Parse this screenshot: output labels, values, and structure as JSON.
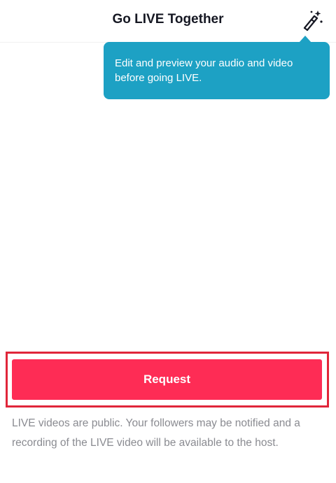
{
  "header": {
    "title": "Go LIVE Together",
    "effects_icon": "magic-wand-icon"
  },
  "tooltip": {
    "text": "Edit and preview your audio and video before going LIVE."
  },
  "request_button": {
    "label": "Request"
  },
  "disclaimer": {
    "text": "LIVE videos are public. Your followers may be notified and a recording of the LIVE video will be available to the host."
  },
  "colors": {
    "accent": "#fe2c55",
    "tooltip": "#1da1c4",
    "highlight": "#e0263a",
    "muted_text": "#8a8b91",
    "title_text": "#161823"
  }
}
